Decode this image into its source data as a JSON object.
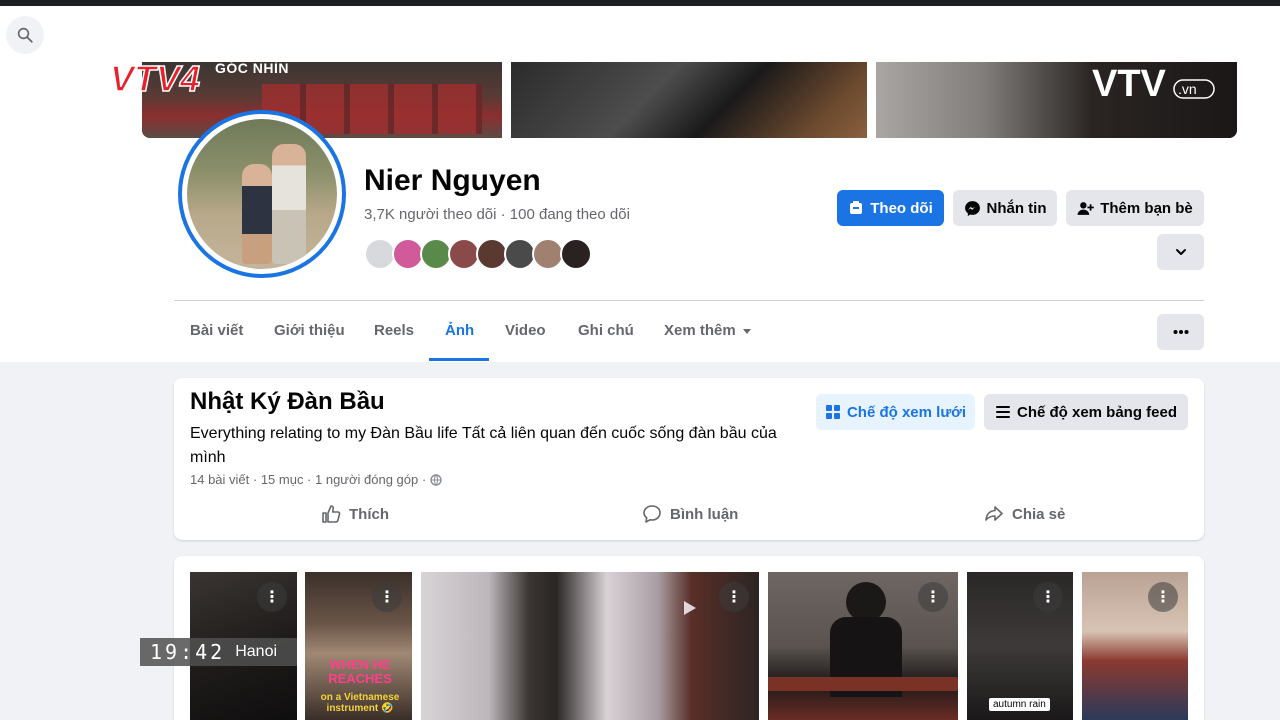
{
  "broadcast": {
    "logo_left": "VTV4",
    "logo_left_sub": "GÓC NHÌN",
    "logo_right": "VTV",
    "logo_right_suffix": ".vn",
    "clock_time": "19:42",
    "clock_city": "Hanoi"
  },
  "profile": {
    "name": "Nier Nguyen",
    "followers": "3,7K người theo dõi · 100 đang theo dõi",
    "friend_avatar_colors": [
      "#d7d9dc",
      "#d05a9a",
      "#5a8a4a",
      "#8a4a4a",
      "#5a3a30",
      "#4a4a4a",
      "#a08070",
      "#2a2220"
    ]
  },
  "actions": {
    "follow": "Theo dõi",
    "message": "Nhắn tin",
    "add_friend": "Thêm bạn bè"
  },
  "tabs": [
    {
      "label": "Bài viết",
      "active": false
    },
    {
      "label": "Giới thiệu",
      "active": false
    },
    {
      "label": "Reels",
      "active": false
    },
    {
      "label": "Ảnh",
      "active": true
    },
    {
      "label": "Video",
      "active": false
    },
    {
      "label": "Ghi chú",
      "active": false
    },
    {
      "label": "Xem thêm",
      "active": false
    }
  ],
  "album": {
    "title": "Nhật Ký Đàn Bầu",
    "description": "Everything relating to my Đàn Bầu life Tất cả liên quan đến cuốc sống đàn bầu của mình",
    "meta": "14 bài viết · 15 mục · 1 người đóng góp ·",
    "grid_view": "Chế độ xem lưới",
    "feed_view": "Chế độ xem bảng feed",
    "like": "Thích",
    "comment": "Bình luận",
    "share": "Chia sẻ"
  },
  "photos": {
    "overlay_red": "WHEN HE REACHES",
    "overlay_yellow": "on a Vietnamese instrument 🤣",
    "caption": "autumn rain"
  },
  "colors": {
    "accent": "#1b74e4",
    "page_bg": "#f0f2f5",
    "secondary_text": "#65676b"
  }
}
